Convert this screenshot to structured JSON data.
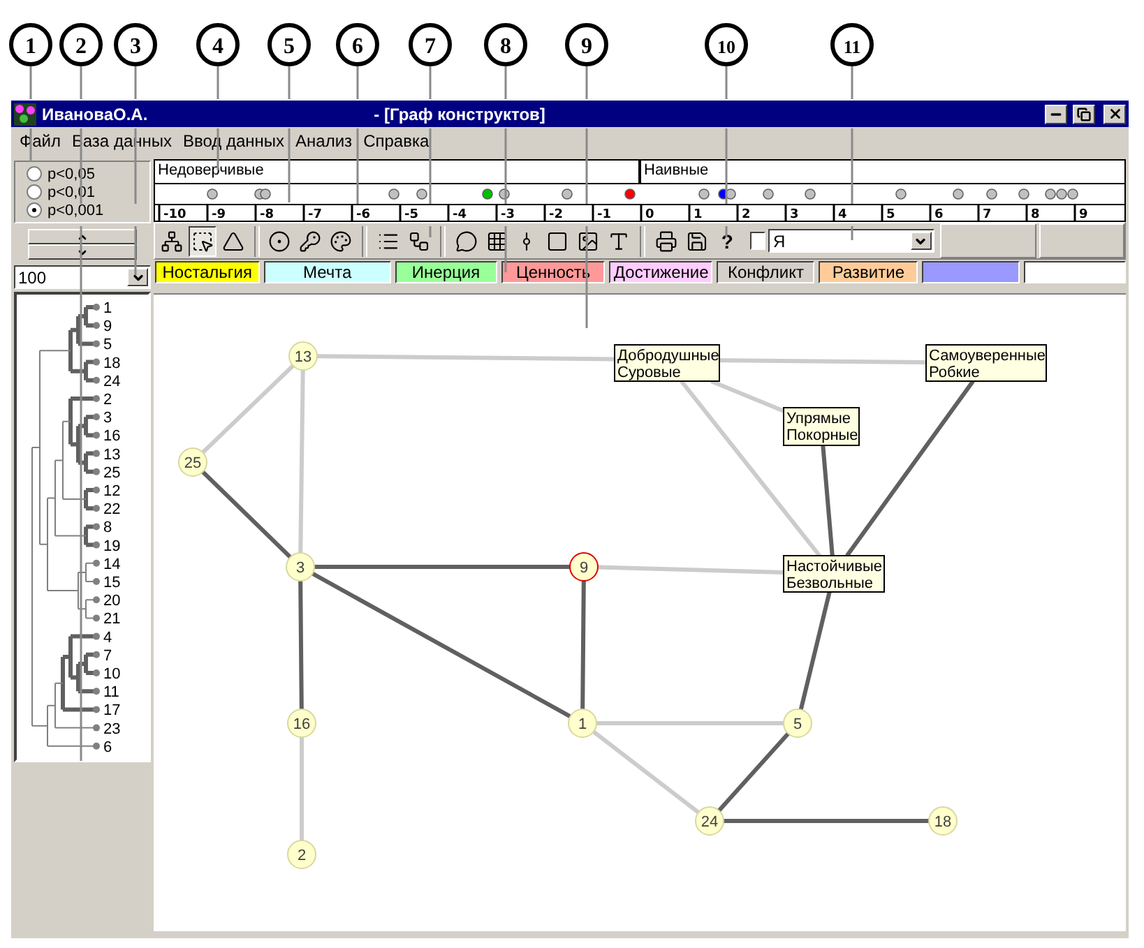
{
  "callouts": [
    "1",
    "2",
    "3",
    "4",
    "5",
    "6",
    "7",
    "8",
    "9",
    "10",
    "11"
  ],
  "window": {
    "owner": "ИвановаО.А.",
    "document": "- [Граф конструктов]"
  },
  "menu": [
    "Файл",
    "База данных",
    "Ввод данных",
    "Анализ",
    "Справка"
  ],
  "significance": [
    {
      "label": "p<0,05",
      "selected": false
    },
    {
      "label": "p<0,01",
      "selected": false
    },
    {
      "label": "p<0,001",
      "selected": true
    }
  ],
  "zoom": {
    "value": "100"
  },
  "dendrogram": {
    "tree": {
      "strong": false,
      "children": [
        {
          "strong": false,
          "children": [
            {
              "strong": true,
              "children": [
                {
                  "strong": true,
                  "children": [
                    {
                      "strong": true,
                      "children": [
                        {
                          "label": "1"
                        },
                        {
                          "label": "9"
                        }
                      ]
                    },
                    {
                      "label": "5"
                    }
                  ]
                },
                {
                  "strong": true,
                  "children": [
                    {
                      "label": "18"
                    },
                    {
                      "label": "24"
                    }
                  ]
                }
              ]
            },
            {
              "strong": false,
              "children": [
                {
                  "strong": false,
                  "children": [
                    {
                      "strong": false,
                      "children": [
                        {
                          "strong": true,
                          "children": [
                            {
                              "label": "2"
                            },
                            {
                              "strong": true,
                              "children": [
                                {
                                  "strong": true,
                                  "children": [
                                    {
                                      "label": "3"
                                    },
                                    {
                                      "label": "16"
                                    }
                                  ]
                                },
                                {
                                  "strong": true,
                                  "children": [
                                    {
                                      "label": "13"
                                    },
                                    {
                                      "label": "25"
                                    }
                                  ]
                                }
                              ]
                            }
                          ]
                        },
                        {
                          "strong": true,
                          "children": [
                            {
                              "label": "12"
                            },
                            {
                              "label": "22"
                            }
                          ]
                        }
                      ]
                    },
                    {
                      "strong": true,
                      "children": [
                        {
                          "label": "8"
                        },
                        {
                          "label": "19"
                        }
                      ]
                    }
                  ]
                },
                {
                  "strong": false,
                  "children": [
                    {
                      "strong": false,
                      "children": [
                        {
                          "label": "14"
                        },
                        {
                          "label": "15"
                        }
                      ]
                    },
                    {
                      "strong": false,
                      "children": [
                        {
                          "label": "20"
                        },
                        {
                          "label": "21"
                        }
                      ]
                    }
                  ]
                }
              ]
            }
          ]
        },
        {
          "strong": false,
          "children": [
            {
              "strong": false,
              "children": [
                {
                  "strong": true,
                  "children": [
                    {
                      "strong": true,
                      "children": [
                        {
                          "label": "4"
                        },
                        {
                          "strong": true,
                          "children": [
                            {
                              "strong": true,
                              "children": [
                                {
                                  "label": "7"
                                },
                                {
                                  "label": "10"
                                }
                              ]
                            },
                            {
                              "label": "11"
                            }
                          ]
                        }
                      ]
                    },
                    {
                      "label": "17"
                    }
                  ]
                },
                {
                  "label": "23"
                }
              ]
            },
            {
              "label": "6"
            }
          ]
        }
      ]
    }
  },
  "poles": [
    "Недоверчивые",
    "Наивные"
  ],
  "scale": {
    "dots": [
      {
        "color": "#c0c0c0"
      },
      {
        "color": "#c0c0c0"
      },
      {
        "color": "#c0c0c0"
      },
      {
        "color": "#c0c0c0"
      },
      {
        "color": "#c0c0c0"
      },
      {
        "color": "#00c000"
      },
      {
        "color": "#c0c0c0"
      },
      {
        "color": "#c0c0c0"
      },
      {
        "color": "#ff0000"
      },
      {
        "color": "#c0c0c0"
      },
      {
        "color": "#0000ff"
      },
      {
        "color": "#c0c0c0"
      },
      {
        "color": "#c0c0c0"
      },
      {
        "color": "#c0c0c0"
      },
      {
        "color": "#c0c0c0"
      },
      {
        "color": "#c0c0c0"
      },
      {
        "color": "#c0c0c0"
      },
      {
        "color": "#c0c0c0"
      },
      {
        "color": "#c0c0c0"
      },
      {
        "color": "#c0c0c0"
      },
      {
        "color": "#c0c0c0"
      }
    ],
    "ticks": [
      "-10",
      "-9",
      "-8",
      "-7",
      "-6",
      "-5",
      "-4",
      "-3",
      "-2",
      "-1",
      "0",
      "1",
      "2",
      "3",
      "4",
      "5",
      "6",
      "7",
      "8",
      "9"
    ]
  },
  "toolbar": {
    "groups": [
      [
        {
          "pressed": false
        },
        {
          "pressed": true
        },
        {
          "pressed": false
        }
      ],
      [
        {
          "pressed": false
        },
        {
          "pressed": false
        },
        {
          "pressed": false
        }
      ],
      [
        {
          "pressed": false
        },
        {
          "pressed": false
        }
      ],
      [
        {
          "pressed": false
        },
        {
          "pressed": false
        },
        {
          "pressed": false
        },
        {
          "pressed": false
        },
        {
          "pressed": false
        },
        {
          "pressed": false
        }
      ],
      [
        {
          "pressed": false
        },
        {
          "pressed": false
        },
        {
          "pressed": false,
          "label": "?"
        }
      ]
    ],
    "checkbox": {
      "checked": false
    },
    "subject": {
      "value": "Я"
    }
  },
  "categories": [
    {
      "label": "Ностальгия",
      "color": "#ffff00"
    },
    {
      "label": "Мечта",
      "color": "#ccffff"
    },
    {
      "label": "Инерция",
      "color": "#99ff99"
    },
    {
      "label": "Ценность",
      "color": "#ff9999"
    },
    {
      "label": "Достижение",
      "color": "#ffccff"
    },
    {
      "label": "Конфликт",
      "color": "#d4d0c8"
    },
    {
      "label": "Развитие",
      "color": "#ffcc99"
    },
    {
      "color": "#9999ff"
    },
    {
      "color": "#ffffff"
    }
  ],
  "graph": {
    "nodes": [
      {
        "kind": "circle",
        "label": "13",
        "highlighted": false
      },
      {
        "kind": "circle",
        "label": "25",
        "highlighted": false
      },
      {
        "kind": "circle",
        "label": "3",
        "highlighted": false
      },
      {
        "kind": "circle",
        "label": "9",
        "highlighted": true
      },
      {
        "kind": "circle",
        "label": "16",
        "highlighted": false
      },
      {
        "kind": "circle",
        "label": "2",
        "highlighted": false
      },
      {
        "kind": "circle",
        "label": "1",
        "highlighted": false
      },
      {
        "kind": "circle",
        "label": "5",
        "highlighted": false
      },
      {
        "kind": "circle",
        "label": "24",
        "highlighted": false
      },
      {
        "kind": "circle",
        "label": "18",
        "highlighted": false
      },
      {
        "kind": "box",
        "lines": [
          "Добродушные",
          "Суровые"
        ]
      },
      {
        "kind": "box",
        "lines": [
          "Самоуверенные",
          "Робкие"
        ]
      },
      {
        "kind": "box",
        "lines": [
          "Упрямые",
          "Покорные"
        ]
      },
      {
        "kind": "box",
        "lines": [
          "Настойчивые",
          "Безвольные"
        ]
      }
    ],
    "edges": [
      {
        "kind": "weak"
      },
      {
        "kind": "weak"
      },
      {
        "kind": "weak"
      },
      {
        "kind": "weak"
      },
      {
        "kind": "weak"
      },
      {
        "kind": "weak"
      },
      {
        "kind": "weak"
      },
      {
        "kind": "weak"
      },
      {
        "kind": "weak"
      },
      {
        "kind": "strong"
      },
      {
        "kind": "strong"
      },
      {
        "kind": "strong"
      },
      {
        "kind": "strong"
      },
      {
        "kind": "strong"
      },
      {
        "kind": "strong"
      },
      {
        "kind": "strong"
      },
      {
        "kind": "strong"
      },
      {
        "kind": "strong"
      },
      {
        "kind": "strong"
      }
    ]
  }
}
